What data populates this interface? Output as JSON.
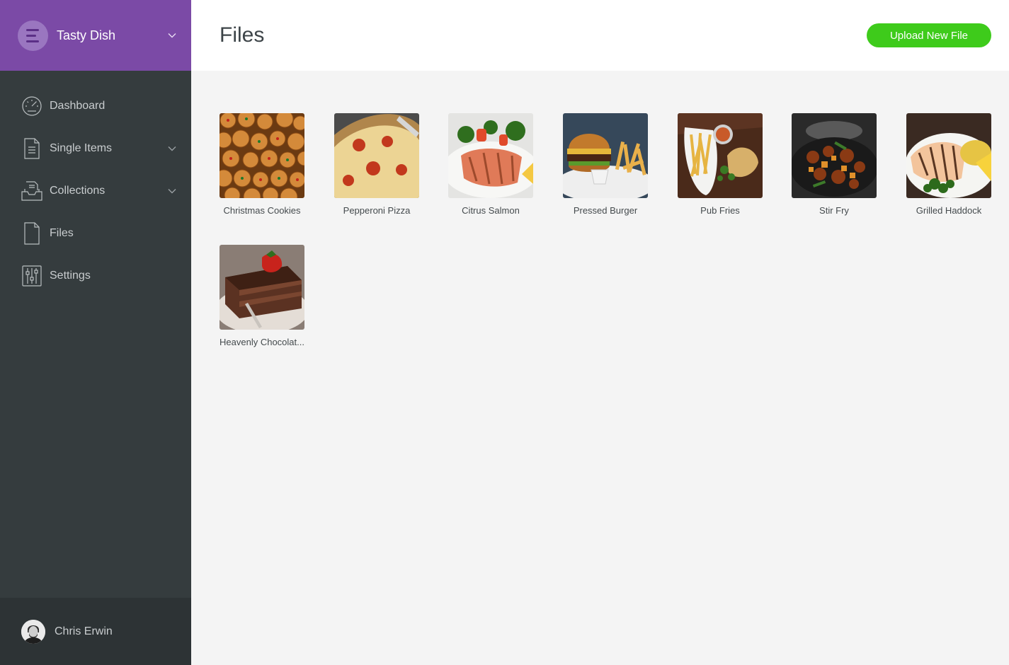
{
  "sidebar": {
    "brand": {
      "name": "Tasty Dish",
      "logo_icon": "menu-lines-icon",
      "chevron_icon": "chevron-down-icon"
    },
    "items": [
      {
        "label": "Dashboard",
        "icon": "gauge-icon",
        "has_submenu": false
      },
      {
        "label": "Single Items",
        "icon": "document-icon",
        "has_submenu": true
      },
      {
        "label": "Collections",
        "icon": "inbox-stack-icon",
        "has_submenu": true
      },
      {
        "label": "Files",
        "icon": "file-icon",
        "has_submenu": false
      },
      {
        "label": "Settings",
        "icon": "sliders-icon",
        "has_submenu": false
      }
    ],
    "user": {
      "name": "Chris Erwin",
      "avatar_icon": "user-avatar"
    }
  },
  "header": {
    "title": "Files",
    "upload_label": "Upload New File"
  },
  "files": [
    {
      "name": "Christmas Cookies"
    },
    {
      "name": "Pepperoni Pizza"
    },
    {
      "name": "Citrus Salmon"
    },
    {
      "name": "Pressed Burger"
    },
    {
      "name": "Pub Fries"
    },
    {
      "name": "Stir Fry"
    },
    {
      "name": "Grilled Haddock"
    },
    {
      "name": "Heavenly Chocolat..."
    }
  ],
  "colors": {
    "brand_purple": "#7b4aa6",
    "sidebar_bg": "#353c3e",
    "upload_green": "#3ecb1b",
    "content_bg": "#f4f4f4"
  }
}
